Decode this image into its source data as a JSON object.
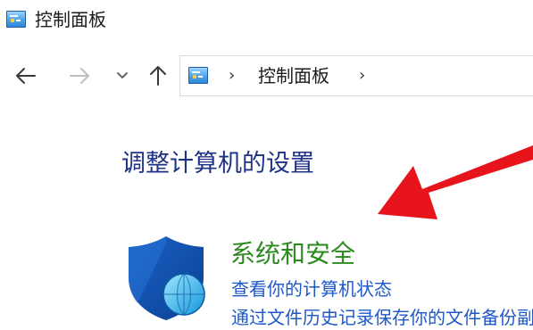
{
  "window": {
    "title": "控制面板",
    "icon": "control-panel-icon"
  },
  "navigation": {
    "back_icon": "arrow-left-icon",
    "forward_icon": "arrow-right-icon",
    "recent_icon": "chevron-down-icon",
    "up_icon": "arrow-up-icon"
  },
  "address_bar": {
    "icon": "control-panel-icon",
    "separator": "›",
    "crumbs": [
      "控制面板"
    ]
  },
  "main": {
    "heading": "调整计算机的设置",
    "categories": [
      {
        "icon": "shield-icon",
        "title": "系统和安全",
        "links": [
          "查看你的计算机状态",
          "通过文件历史记录保存你的文件备份副本"
        ]
      }
    ]
  },
  "annotation": {
    "arrow_color": "#e8141b"
  }
}
